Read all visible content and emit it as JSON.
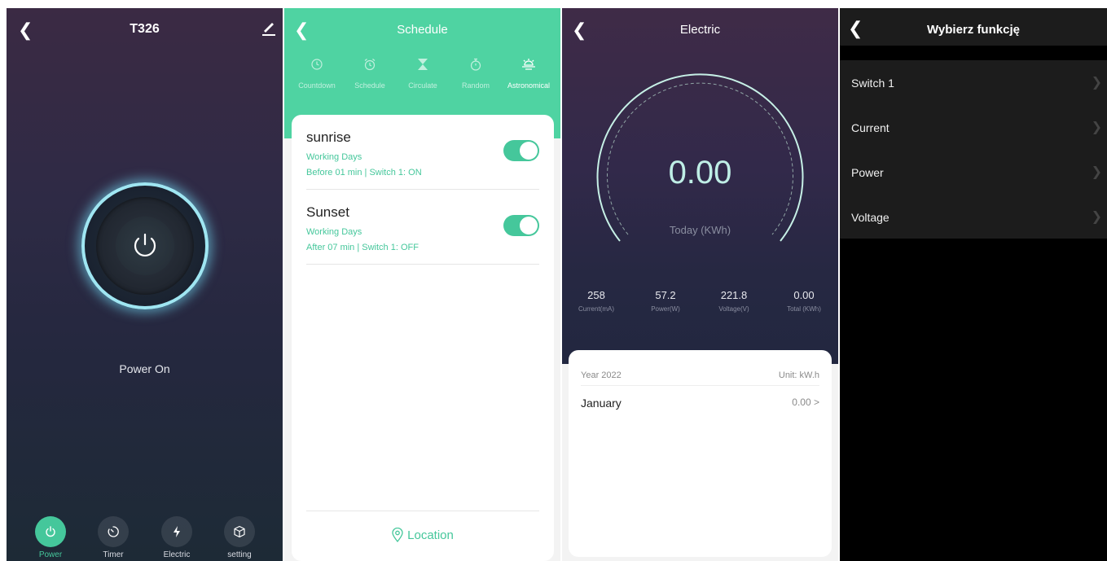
{
  "colors": {
    "accent": "#45c79b",
    "header_green": "#4fd3a2",
    "glow": "#9fe6f2",
    "dark_bg": "#2e2a45",
    "black": "#000000"
  },
  "power_screen": {
    "title": "T326",
    "back_icon": "chevron-left-icon",
    "edit_icon": "edit-pencil-icon",
    "power_icon": "power-icon",
    "status": "Power On",
    "tabs": [
      {
        "label": "Power",
        "icon": "power-icon",
        "active": true
      },
      {
        "label": "Timer",
        "icon": "timer-icon",
        "active": false
      },
      {
        "label": "Electric",
        "icon": "lightning-icon",
        "active": false
      },
      {
        "label": "setting",
        "icon": "cube-icon",
        "active": false
      }
    ]
  },
  "schedule_screen": {
    "title": "Schedule",
    "modes": [
      {
        "label": "Countdown",
        "icon": "clock-icon",
        "active": false
      },
      {
        "label": "Schedule",
        "icon": "alarm-icon",
        "active": false
      },
      {
        "label": "Circulate",
        "icon": "hourglass-icon",
        "active": false
      },
      {
        "label": "Random",
        "icon": "stopwatch-icon",
        "active": false
      },
      {
        "label": "Astronomical",
        "icon": "sun-icon",
        "active": true
      }
    ],
    "items": [
      {
        "name": "sunrise",
        "days": "Working Days",
        "desc": "Before 01 min | Switch 1: ON",
        "enabled": true
      },
      {
        "name": "Sunset",
        "days": "Working Days",
        "desc": "After 07 min | Switch 1: OFF",
        "enabled": true
      }
    ],
    "location_label": "Location"
  },
  "electric_screen": {
    "title": "Electric",
    "today_value": "0.00",
    "today_label": "Today (KWh)",
    "stats": [
      {
        "value": "258",
        "label": "Current(mA)"
      },
      {
        "value": "57.2",
        "label": "Power(W)"
      },
      {
        "value": "221.8",
        "label": "Voltage(V)"
      },
      {
        "value": "0.00",
        "label": "Total (KWh)"
      }
    ],
    "year_label": "Year 2022",
    "unit_label": "Unit: kW.h",
    "months": [
      {
        "name": "January",
        "value": "0.00 >"
      }
    ]
  },
  "function_screen": {
    "title": "Wybierz funkcję",
    "items": [
      {
        "label": "Switch 1"
      },
      {
        "label": "Current"
      },
      {
        "label": "Power"
      },
      {
        "label": "Voltage"
      }
    ]
  }
}
